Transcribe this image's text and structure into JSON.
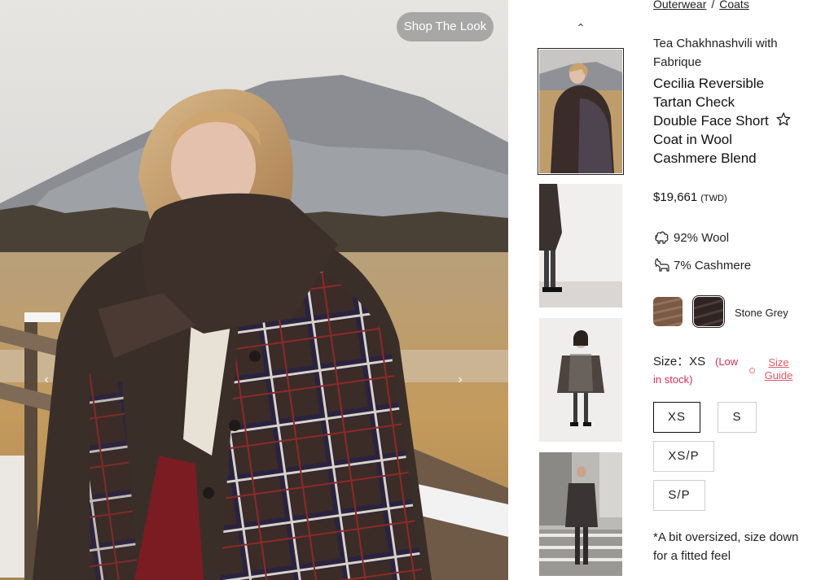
{
  "hero": {
    "shop_the_look": "Shop The Look",
    "prev_icon": "chevron-left-icon",
    "next_icon": "chevron-right-icon"
  },
  "thumbnails": {
    "up_icon": "chevron-up-icon",
    "items": [
      {
        "alt": "",
        "selected": true
      },
      {
        "alt": "",
        "selected": false
      },
      {
        "alt": "",
        "selected": false
      },
      {
        "alt": "",
        "selected": false
      }
    ]
  },
  "breadcrumb": {
    "items": [
      "Outerwear",
      "Coats"
    ],
    "separator": "/"
  },
  "product": {
    "designer": "Tea Chakhnashvili with Fabrique",
    "title": "Cecilia Reversible Tartan Check Double Face Short Coat in Wool Cashmere Blend",
    "favorite_icon": "star-outline-icon",
    "price": "$19,661",
    "currency": "(TWD)",
    "composition": [
      {
        "icon": "sheep-icon",
        "label": "92% Wool"
      },
      {
        "icon": "goat-icon",
        "label": "7% Cashmere"
      }
    ],
    "colors": {
      "swatches": [
        {
          "name": "brown-swatch",
          "color": "#7a5a45",
          "selected": false
        },
        {
          "name": "stone-grey-swatch",
          "color": "#2e2522",
          "selected": true
        }
      ],
      "selected_name": "Stone Grey"
    },
    "size": {
      "label": "Size：XS",
      "stock": "(Low in stock)",
      "guide": "Size Guide",
      "options": [
        {
          "label": "XS",
          "selected": true
        },
        {
          "label": "S",
          "selected": false
        },
        {
          "label": "XS/P",
          "selected": false
        },
        {
          "label": "S/P",
          "selected": false
        }
      ]
    },
    "fit_note": "*A bit oversized, size down for a fitted feel"
  },
  "colors": {
    "accent_pink": "#d0305a",
    "border": "#cfcfcf",
    "text": "#222222"
  }
}
